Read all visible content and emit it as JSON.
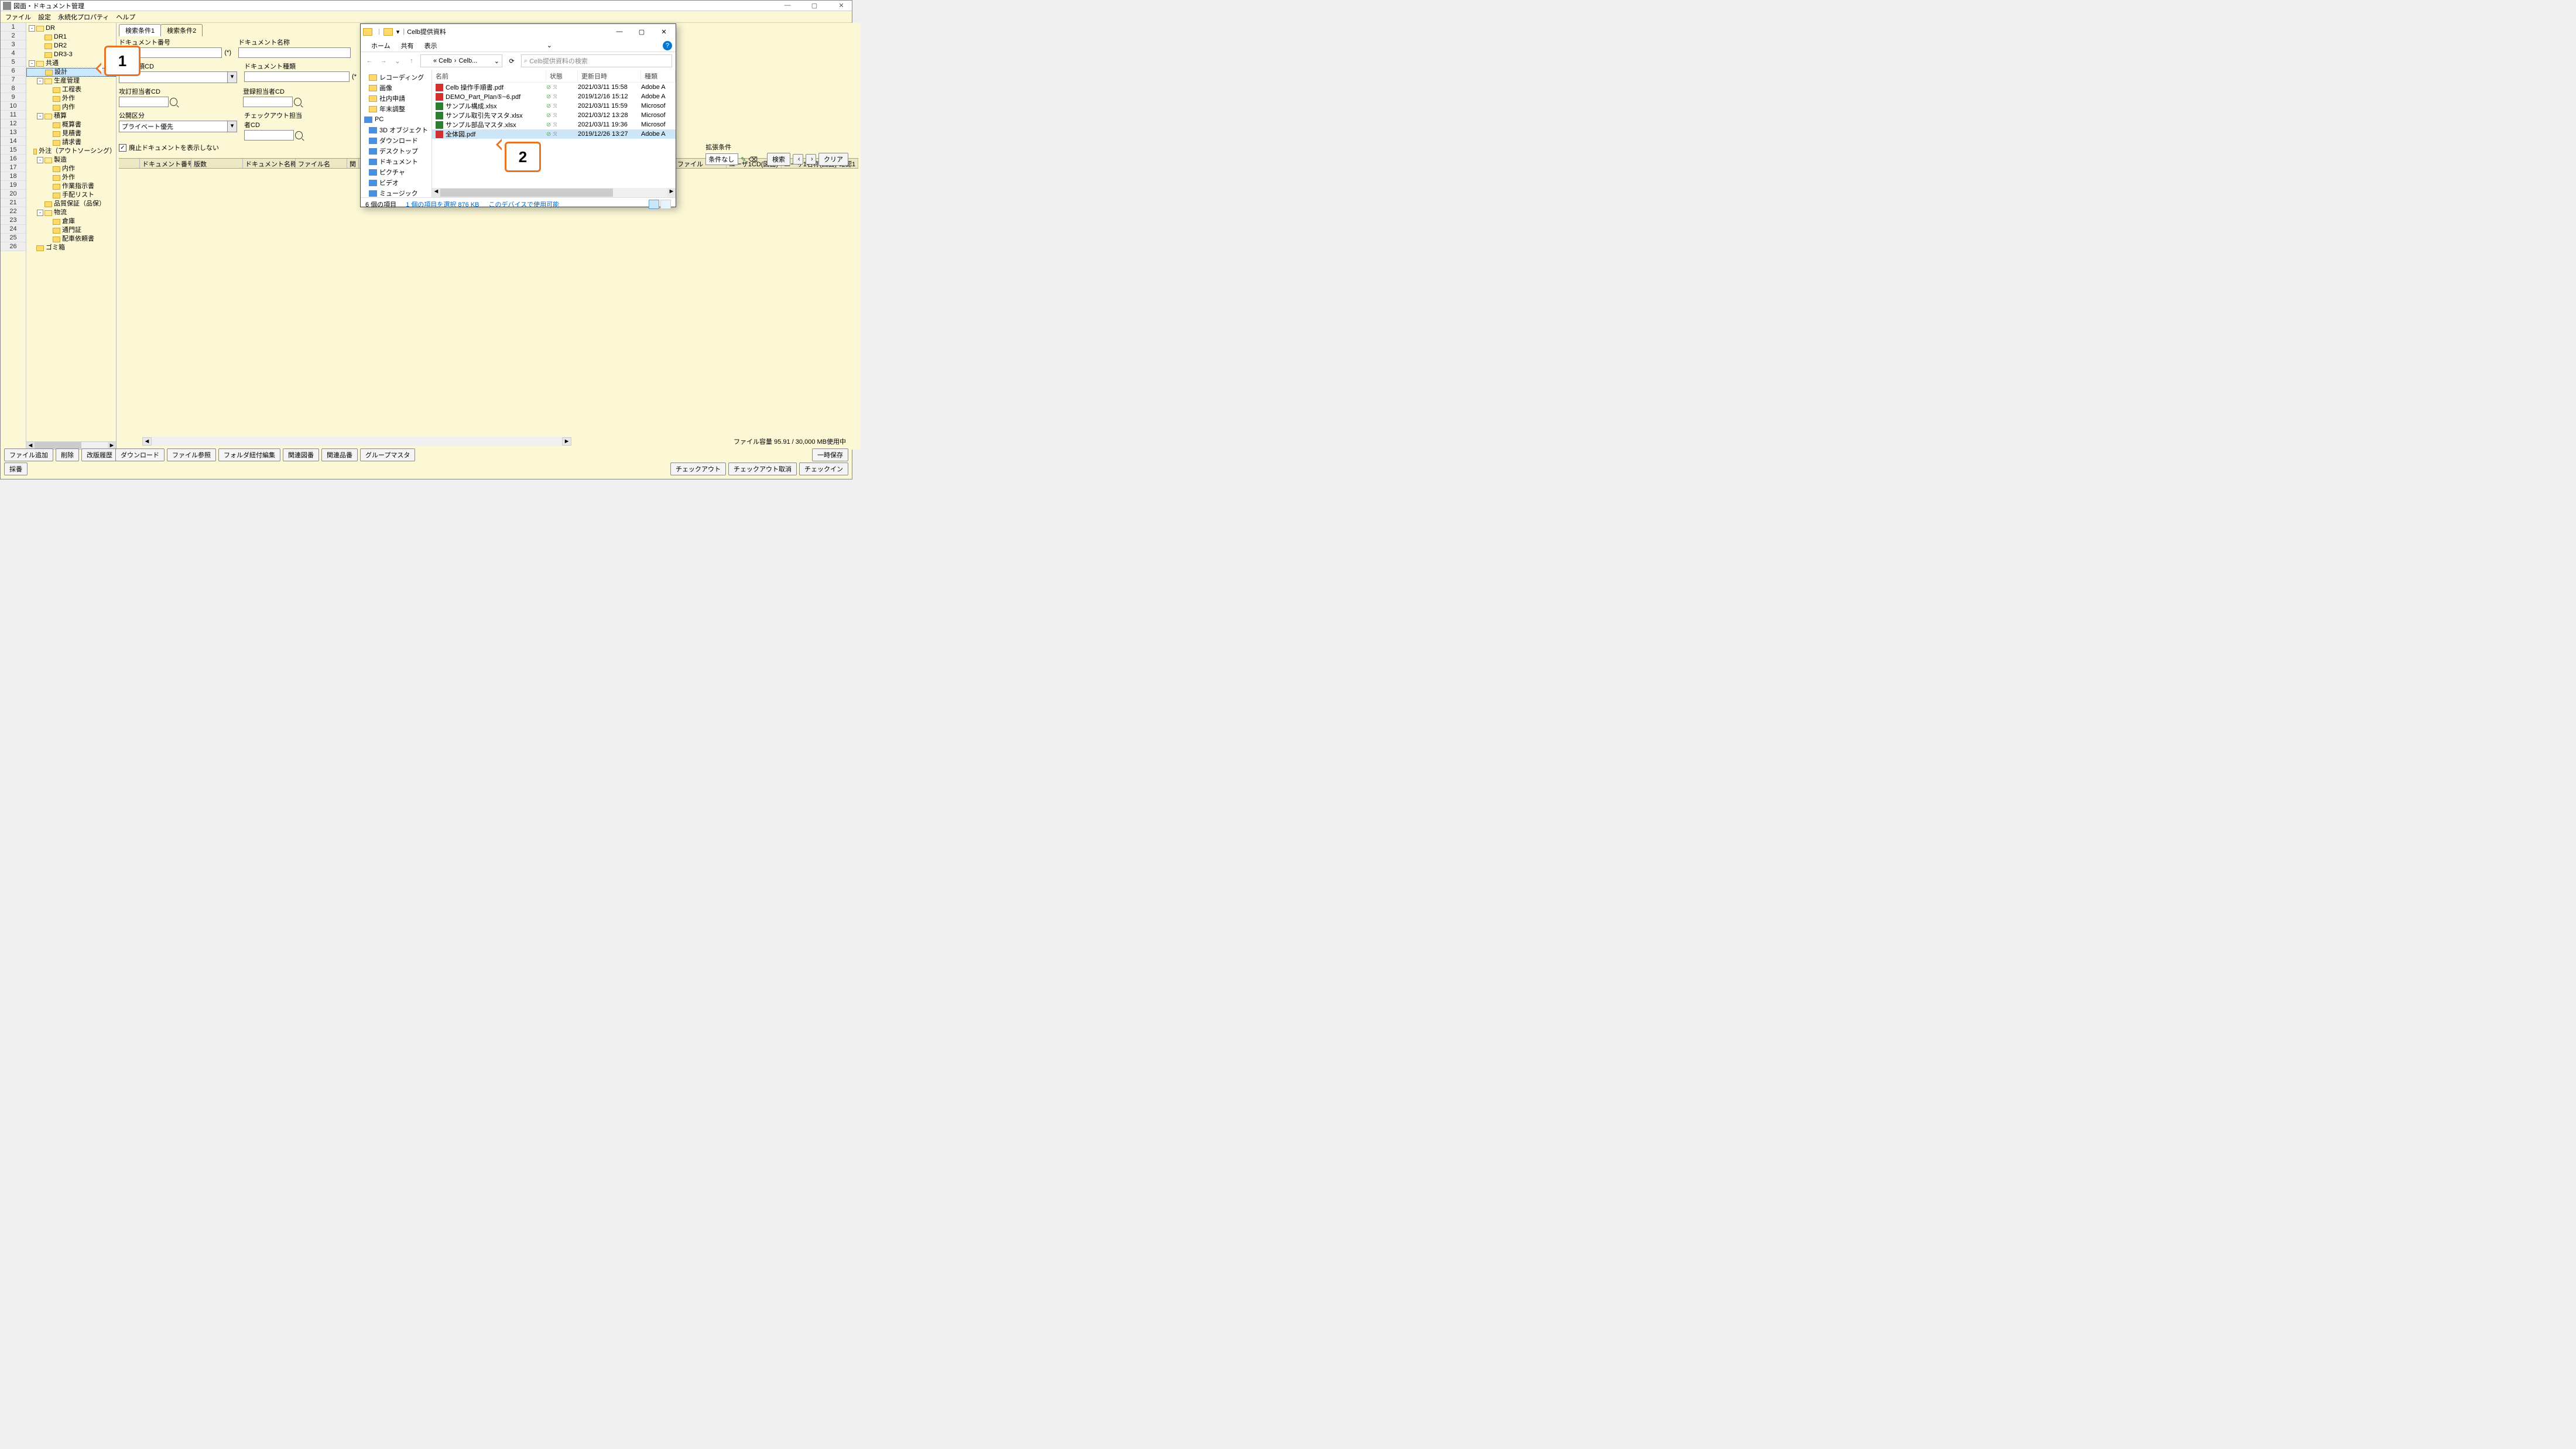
{
  "app": {
    "title": "図面・ドキュメント管理",
    "menus": [
      "ファイル",
      "設定",
      "永続化プロパティ",
      "ヘルプ"
    ]
  },
  "tree": {
    "rows": 26,
    "items": [
      {
        "depth": 0,
        "toggle": "-",
        "label": "DR",
        "open": true
      },
      {
        "depth": 1,
        "toggle": "",
        "label": "DR1"
      },
      {
        "depth": 1,
        "toggle": "",
        "label": "DR2"
      },
      {
        "depth": 1,
        "toggle": "",
        "label": "DR3-3"
      },
      {
        "depth": 0,
        "toggle": "-",
        "label": "共通",
        "open": true
      },
      {
        "depth": 1,
        "toggle": "",
        "label": "設計",
        "selected": true
      },
      {
        "depth": 1,
        "toggle": "-",
        "label": "生産管理",
        "open": true
      },
      {
        "depth": 2,
        "toggle": "",
        "label": "工程表"
      },
      {
        "depth": 2,
        "toggle": "",
        "label": "外作"
      },
      {
        "depth": 2,
        "toggle": "",
        "label": "内作"
      },
      {
        "depth": 1,
        "toggle": "-",
        "label": "積算",
        "open": true
      },
      {
        "depth": 2,
        "toggle": "",
        "label": "概算書"
      },
      {
        "depth": 2,
        "toggle": "",
        "label": "見積書"
      },
      {
        "depth": 2,
        "toggle": "",
        "label": "請求書"
      },
      {
        "depth": 1,
        "toggle": "",
        "label": "外注（アウトソーシング）"
      },
      {
        "depth": 1,
        "toggle": "-",
        "label": "製造",
        "open": true
      },
      {
        "depth": 2,
        "toggle": "",
        "label": "内作"
      },
      {
        "depth": 2,
        "toggle": "",
        "label": "外作"
      },
      {
        "depth": 2,
        "toggle": "",
        "label": "作業指示書"
      },
      {
        "depth": 2,
        "toggle": "",
        "label": "手配リスト"
      },
      {
        "depth": 1,
        "toggle": "",
        "label": "品質保証（品保）"
      },
      {
        "depth": 1,
        "toggle": "-",
        "label": "物流",
        "open": true
      },
      {
        "depth": 2,
        "toggle": "",
        "label": "倉庫"
      },
      {
        "depth": 2,
        "toggle": "",
        "label": "通門証"
      },
      {
        "depth": 2,
        "toggle": "",
        "label": "配車依頼書"
      },
      {
        "depth": 0,
        "toggle": "",
        "label": "ゴミ箱"
      }
    ]
  },
  "search": {
    "tabs": [
      "検索条件1",
      "検索条件2"
    ],
    "f_docno": "ドキュメント番号",
    "suffix_docno": "(*)",
    "f_docname": "ドキュメント名称",
    "f_classcd": "ント分類CD",
    "f_doctype": "ドキュメント種類",
    "suffix_doctype": "(*",
    "f_revised": "攻訂担当者CD",
    "f_registered": "登録担当者CD",
    "f_public": "公開区分",
    "public_value": "プライベート優先",
    "f_checkout": "チェックアウト担当者CD",
    "chk_label": "廃止ドキュメントを表示しない",
    "chk_checked": "✓"
  },
  "ext": {
    "title": "拡張条件",
    "combo": "条件なし",
    "search_btn": "検索",
    "clear_btn": "クリア",
    "prev": "‹",
    "next": "›"
  },
  "grid_cols": [
    "ドキュメント番号",
    "版数",
    "ドキュメント名称",
    "ファイル名",
    "関",
    "ファイル",
    "ユーザ1CD(図面)",
    "ユーザ1名称(図面)",
    "確認1"
  ],
  "status": "ファイル容量  95.91 / 30,000  MB使用中",
  "btm_left1": [
    "ファイル追加",
    "削除",
    "改版履歴"
  ],
  "btm_left2": [
    "ダウンロード",
    "ファイル参照",
    "フォルダ紐付編集",
    "関連図番",
    "関連品番",
    "グループマスタ"
  ],
  "btm_right1": "一時保存",
  "btm_left3": "採番",
  "btm_right2": [
    "チェックアウト",
    "チェックアウト取消",
    "チェックイン"
  ],
  "explorer": {
    "title_path": "Celb提供資料",
    "ribbon": [
      "ホーム",
      "共有",
      "表示"
    ],
    "path": [
      "« Celb",
      "Celb..."
    ],
    "search_placeholder": "Celb提供資料の検索",
    "tree": [
      {
        "type": "folder",
        "label": "レコーディング"
      },
      {
        "type": "folder",
        "label": "画像"
      },
      {
        "type": "folder",
        "label": "社内申請"
      },
      {
        "type": "folder",
        "label": "年末調整"
      },
      {
        "type": "pc",
        "label": "PC"
      },
      {
        "type": "obj",
        "label": "3D オブジェクト"
      },
      {
        "type": "dl",
        "label": "ダウンロード"
      },
      {
        "type": "dt",
        "label": "デスクトップ"
      },
      {
        "type": "doc",
        "label": "ドキュメント"
      },
      {
        "type": "pic",
        "label": "ピクチャ"
      },
      {
        "type": "vid",
        "label": "ビデオ"
      },
      {
        "type": "mus",
        "label": "ミュージック"
      }
    ],
    "cols": [
      "名前",
      "状態",
      "更新日時",
      "種類"
    ],
    "files": [
      {
        "icon": "pdf",
        "name": "Celb 操作手順書.pdf",
        "date": "2021/03/11 15:58",
        "type": "Adobe A"
      },
      {
        "icon": "pdf",
        "name": "DEMO_Part_Plan⑤~6.pdf",
        "date": "2019/12/16 15:12",
        "type": "Adobe A"
      },
      {
        "icon": "xlsx",
        "name": "サンプル構成.xlsx",
        "date": "2021/03/11 15:59",
        "type": "Microsof"
      },
      {
        "icon": "xlsx",
        "name": "サンプル取引先マスタ.xlsx",
        "date": "2021/03/12 13:28",
        "type": "Microsof"
      },
      {
        "icon": "xlsx",
        "name": "サンプル部品マスタ.xlsx",
        "date": "2021/03/11 19:36",
        "type": "Microsof"
      },
      {
        "icon": "pdf",
        "name": "全体図.pdf",
        "date": "2019/12/26 13:27",
        "type": "Adobe A",
        "selected": true
      }
    ],
    "status1": "6 個の項目",
    "status2": "1 個の項目を選択 876 KB",
    "status3": "このデバイスで使用可能"
  },
  "callouts": {
    "c1": "1",
    "c2": "2"
  }
}
